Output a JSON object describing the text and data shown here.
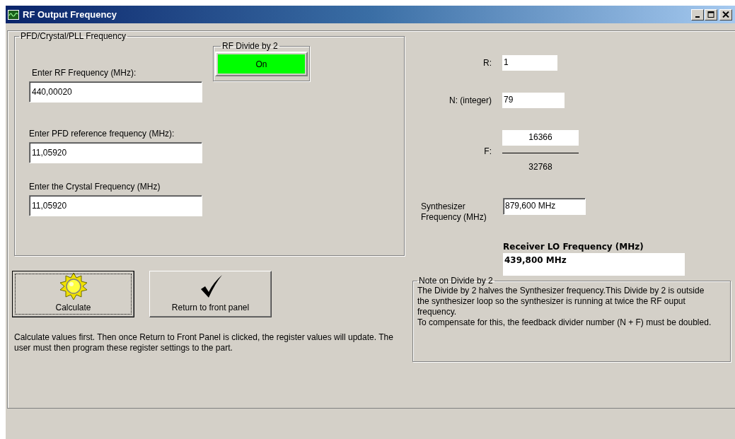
{
  "window": {
    "title": "RF Output Frequency"
  },
  "input_group": {
    "title": "PFD/Crystal/PLL Frequency",
    "fields": [
      {
        "label": "Enter RF Frequency (MHz):",
        "value": "440,00020"
      },
      {
        "label": "Enter PFD reference frequency (MHz):",
        "value": "11,05920"
      },
      {
        "label": "Enter the Crystal Frequency (MHz)",
        "value": "11,05920"
      }
    ],
    "divide_by_2": {
      "title": "RF Divide by 2",
      "button": "On",
      "on": true
    }
  },
  "buttons": [
    {
      "label": "Calculate",
      "kind": "sun",
      "focused": true
    },
    {
      "label": "Return to front panel",
      "kind": "check",
      "focused": false
    }
  ],
  "instructions": "Calculate values first. Then once Return to Front Panel is clicked, the register values will update. The user must then program these register settings to the part.",
  "results": {
    "r": {
      "label": "R:",
      "value": "1"
    },
    "n": {
      "label": "N: (integer)",
      "value": "79"
    },
    "f": {
      "label": "F:",
      "numerator": "16366",
      "denominator": "32768"
    },
    "synth": {
      "label": "Synthesizer Frequency (MHz)",
      "value": "879,600 MHz"
    },
    "lo": {
      "label": "Receiver LO Frequency (MHz)",
      "value": "439,800 MHz"
    }
  },
  "note": {
    "title": "Note on Divide by 2",
    "paragraphs": [
      "The Divide by 2 halves the Synthesizer frequency.This Divide by 2 is outside the synthesizer loop so the synthesizer is running at twice the RF ouput frequency.",
      "To compensate for this, the feedback divider number (N + F) must be doubled."
    ]
  }
}
